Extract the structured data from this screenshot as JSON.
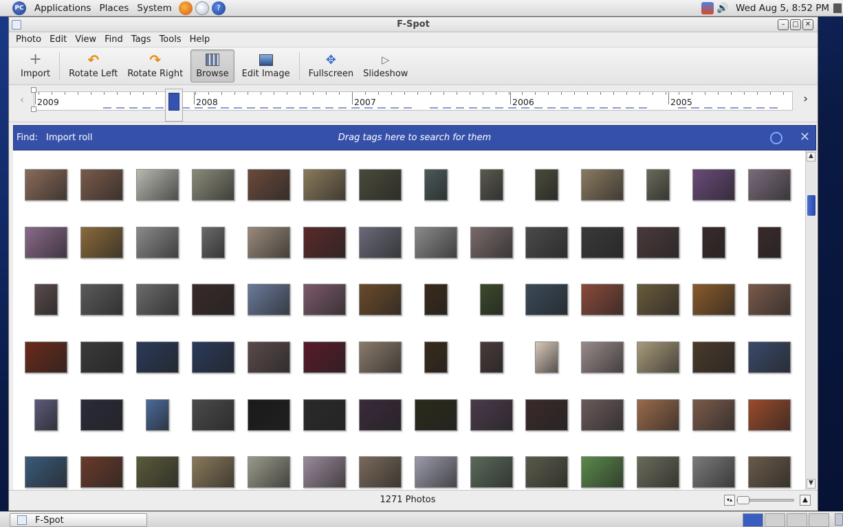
{
  "top_panel": {
    "logo": "PC",
    "menus": [
      "Applications",
      "Places",
      "System"
    ],
    "clock": "Wed Aug  5,  8:52 PM"
  },
  "window": {
    "title": "F-Spot",
    "menus": [
      "Photo",
      "Edit",
      "View",
      "Find",
      "Tags",
      "Tools",
      "Help"
    ]
  },
  "toolbar": {
    "import": "Import",
    "rotate_left": "Rotate Left",
    "rotate_right": "Rotate Right",
    "browse": "Browse",
    "edit_image": "Edit Image",
    "fullscreen": "Fullscreen",
    "slideshow": "Slideshow"
  },
  "timeline": {
    "years": [
      "2009",
      "2008",
      "2007",
      "2006",
      "2005"
    ]
  },
  "findbar": {
    "label": "Find:",
    "tag": "Import roll",
    "hint": "Drag tags here to search for them"
  },
  "status": {
    "count": "1271 Photos"
  },
  "taskbar": {
    "task": "F-Spot"
  },
  "colors": {
    "accent": "#3550a8",
    "findbar_text": "#ffffff"
  },
  "photos": [
    [
      "L",
      "#8a6a58"
    ],
    [
      "L",
      "#7a5a4a"
    ],
    [
      "L",
      "#b8b8b0"
    ],
    [
      "L",
      "#8a8a7a"
    ],
    [
      "L",
      "#6a4a3a"
    ],
    [
      "L",
      "#8a7a5a"
    ],
    [
      "L",
      "#4a4a3a"
    ],
    [
      "P",
      "#4a5a5a"
    ],
    [
      "P",
      "#5a5a50"
    ],
    [
      "P",
      "#4a4a3a"
    ],
    [
      "L",
      "#8a7a60"
    ],
    [
      "P",
      "#6a6a5a"
    ],
    [
      "L",
      "#6a4a7a"
    ],
    [
      "L",
      "#7a6a7a"
    ],
    [
      "L",
      "#8a6a8a"
    ],
    [
      "L",
      "#8a6a3a"
    ],
    [
      "L",
      "#8a8a8a"
    ],
    [
      "P",
      "#6a6a6a"
    ],
    [
      "L",
      "#9a8a7a"
    ],
    [
      "L",
      "#5a2a2a"
    ],
    [
      "L",
      "#6a6a7a"
    ],
    [
      "L",
      "#8a8a8a"
    ],
    [
      "L",
      "#7a6a6a"
    ],
    [
      "L",
      "#4a4a4a"
    ],
    [
      "L",
      "#3a3a3a"
    ],
    [
      "L",
      "#4a3a3a"
    ],
    [
      "P",
      "#3a2a2a"
    ],
    [
      "P",
      "#3a2a2a"
    ],
    [
      "P",
      "#5a4a4a"
    ],
    [
      "L",
      "#5a5a5a"
    ],
    [
      "L",
      "#6a6a6a"
    ],
    [
      "L",
      "#3a2a2a"
    ],
    [
      "L",
      "#6a7a9a"
    ],
    [
      "L",
      "#7a5a6a"
    ],
    [
      "L",
      "#6a4a2a"
    ],
    [
      "P",
      "#3a2a1a"
    ],
    [
      "P",
      "#3a4a2a"
    ],
    [
      "L",
      "#3a4a5a"
    ],
    [
      "L",
      "#8a4a3a"
    ],
    [
      "L",
      "#6a5a3a"
    ],
    [
      "L",
      "#8a5a2a"
    ],
    [
      "L",
      "#7a5a4a"
    ],
    [
      "L",
      "#6a2a1a"
    ],
    [
      "L",
      "#3a3a3a"
    ],
    [
      "L",
      "#2a3a5a"
    ],
    [
      "L",
      "#2a3a5a"
    ],
    [
      "L",
      "#5a4a4a"
    ],
    [
      "L",
      "#5a1a2a"
    ],
    [
      "L",
      "#8a7a6a"
    ],
    [
      "P",
      "#3a2a1a"
    ],
    [
      "P",
      "#4a3a3a"
    ],
    [
      "P",
      "#d8c8b8"
    ],
    [
      "L",
      "#9a8a8a"
    ],
    [
      "L",
      "#a89a7a"
    ],
    [
      "L",
      "#4a3a2a"
    ],
    [
      "L",
      "#3a4a6a"
    ],
    [
      "P",
      "#5a5a7a"
    ],
    [
      "L",
      "#2a2a3a"
    ],
    [
      "P",
      "#4a6a9a"
    ],
    [
      "L",
      "#4a4a4a"
    ],
    [
      "L",
      "#1a1a1a"
    ],
    [
      "L",
      "#2a2a2a"
    ],
    [
      "L",
      "#3a2a3a"
    ],
    [
      "L",
      "#2a2a1a"
    ],
    [
      "L",
      "#4a3a4a"
    ],
    [
      "L",
      "#3a2a2a"
    ],
    [
      "L",
      "#6a5a5a"
    ],
    [
      "L",
      "#9a6a4a"
    ],
    [
      "L",
      "#7a5a4a"
    ],
    [
      "L",
      "#9a4a2a"
    ],
    [
      "L",
      "#3a5a7a"
    ],
    [
      "L",
      "#6a3a2a"
    ],
    [
      "L",
      "#5a5a3a"
    ],
    [
      "L",
      "#8a7a5a"
    ],
    [
      "L",
      "#9a9a8a"
    ],
    [
      "L",
      "#9a8a9a"
    ],
    [
      "L",
      "#7a6a5a"
    ],
    [
      "L",
      "#9a9aaa"
    ],
    [
      "L",
      "#5a6a5a"
    ],
    [
      "L",
      "#5a5a4a"
    ],
    [
      "L",
      "#5a8a4a"
    ],
    [
      "L",
      "#6a6a5a"
    ],
    [
      "L",
      "#7a7a7a"
    ],
    [
      "L",
      "#6a5a4a"
    ]
  ]
}
